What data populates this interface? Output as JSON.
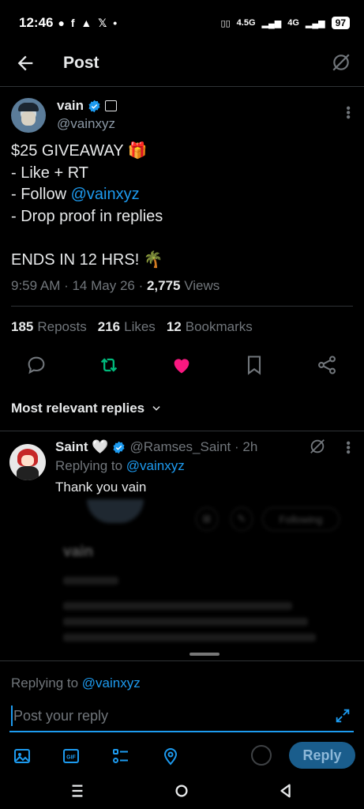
{
  "status_bar": {
    "time": "12:46",
    "notif_icons": "● f ▲ 𝕏 •",
    "network1": "4.5G",
    "network2": "4G",
    "battery": "97"
  },
  "app_bar": {
    "title": "Post"
  },
  "tweet": {
    "author_name": "vain",
    "author_handle": "@vainxyz",
    "line1": "$25 GIVEAWAY 🎁",
    "line2": "- Like + RT",
    "line3_prefix": "- Follow ",
    "line3_link": "@vainxyz",
    "line4": "- Drop proof in replies",
    "line5": "ENDS IN 12 HRS! 🌴",
    "meta_time": "9:59 AM · 14 May 26 · ",
    "meta_views_count": "2,775",
    "meta_views_label": " Views",
    "reposts_count": "185",
    "reposts_label": "Reposts",
    "likes_count": "216",
    "likes_label": "Likes",
    "bookmarks_count": "12",
    "bookmarks_label": "Bookmarks",
    "liked": true
  },
  "sort_label": "Most relevant replies",
  "reply": {
    "name": "Saint 🤍",
    "handle": "@Ramses_Saint · 2h",
    "replying_prefix": "Replying to ",
    "replying_to": "@vainxyz",
    "text": "Thank you vain"
  },
  "blurred_card": {
    "following_label": "Following",
    "name": "vain"
  },
  "composer": {
    "replying_prefix": "Replying to ",
    "replying_to": "@vainxyz",
    "placeholder": "Post your reply",
    "reply_button": "Reply"
  },
  "colors": {
    "accent": "#1d9bf0",
    "like": "#f91880",
    "repost": "#00ba7c",
    "muted": "#71767b"
  }
}
